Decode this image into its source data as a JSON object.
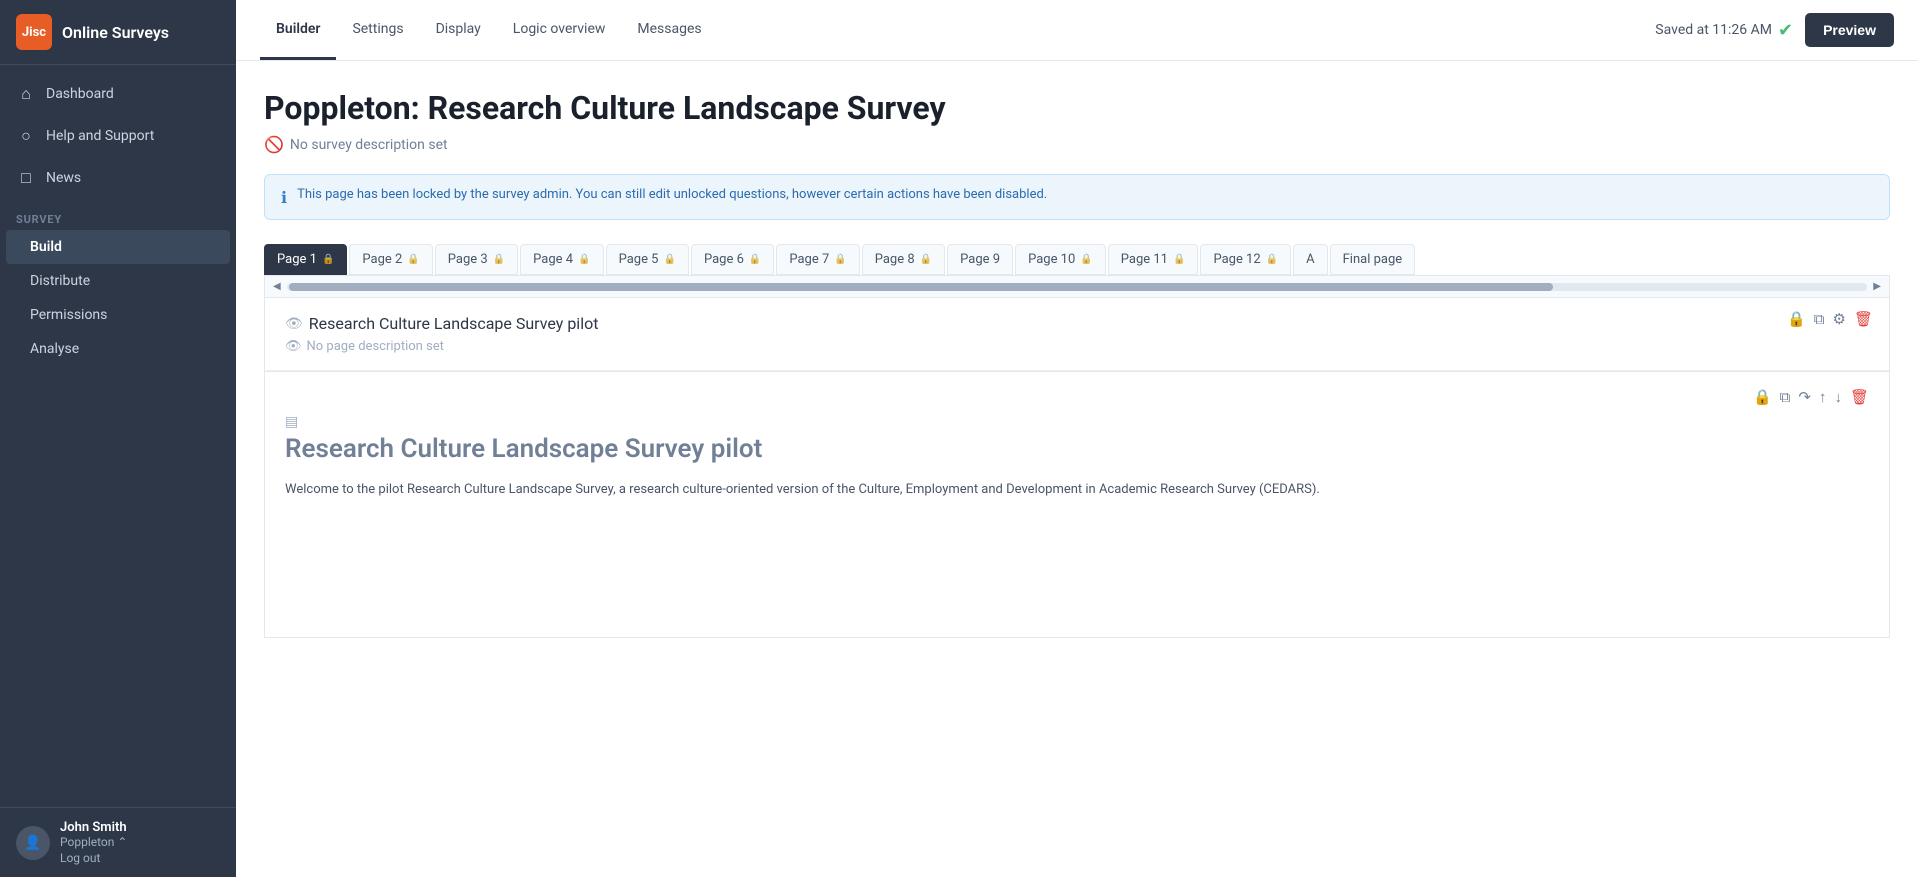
{
  "sidebar": {
    "logo_text": "Online Surveys",
    "jisc_label": "Jisc",
    "nav_items": [
      {
        "id": "dashboard",
        "label": "Dashboard",
        "icon": "⌂"
      },
      {
        "id": "help-support",
        "label": "Help and Support",
        "icon": "○"
      },
      {
        "id": "news",
        "label": "News",
        "icon": "□"
      }
    ],
    "section_label": "SURVEY",
    "survey_sub_items": [
      {
        "id": "build",
        "label": "Build",
        "active": true
      },
      {
        "id": "distribute",
        "label": "Distribute",
        "active": false
      },
      {
        "id": "permissions",
        "label": "Permissions",
        "active": false
      },
      {
        "id": "analyse",
        "label": "Analyse",
        "active": false
      }
    ],
    "user": {
      "name": "John Smith",
      "org": "Poppleton",
      "logout": "Log out"
    }
  },
  "top_nav": {
    "tabs": [
      {
        "id": "builder",
        "label": "Builder",
        "active": true
      },
      {
        "id": "settings",
        "label": "Settings",
        "active": false
      },
      {
        "id": "display",
        "label": "Display",
        "active": false
      },
      {
        "id": "logic-overview",
        "label": "Logic overview",
        "active": false
      },
      {
        "id": "messages",
        "label": "Messages",
        "active": false
      }
    ],
    "saved_status": "Saved at 11:26 AM",
    "preview_label": "Preview"
  },
  "survey": {
    "title": "Poppleton: Research Culture Landscape Survey",
    "description_placeholder": "No survey description set",
    "info_banner": "This page has been locked by the survey admin. You can still edit unlocked questions, however certain actions have been disabled.",
    "pages": [
      {
        "label": "Page 1",
        "locked": true,
        "active": true
      },
      {
        "label": "Page 2",
        "locked": true,
        "active": false
      },
      {
        "label": "Page 3",
        "locked": true,
        "active": false
      },
      {
        "label": "Page 4",
        "locked": true,
        "active": false
      },
      {
        "label": "Page 5",
        "locked": true,
        "active": false
      },
      {
        "label": "Page 6",
        "locked": true,
        "active": false
      },
      {
        "label": "Page 7",
        "locked": true,
        "active": false
      },
      {
        "label": "Page 8",
        "locked": true,
        "active": false
      },
      {
        "label": "Page 9",
        "locked": false,
        "active": false
      },
      {
        "label": "Page 10",
        "locked": true,
        "active": false
      },
      {
        "label": "Page 11",
        "locked": true,
        "active": false
      },
      {
        "label": "Page 12",
        "locked": true,
        "active": false
      },
      {
        "label": "A",
        "locked": false,
        "active": false
      },
      {
        "label": "Final page",
        "locked": false,
        "active": false
      }
    ],
    "current_page": {
      "name": "Research Culture Landscape Survey pilot",
      "no_description": "No page description set"
    },
    "question": {
      "title": "Research Culture Landscape Survey pilot",
      "body": "Welcome to the pilot Research Culture Landscape Survey, a research culture-oriented version of the Culture, Employment and Development in Academic Research Survey (CEDARS)."
    }
  }
}
